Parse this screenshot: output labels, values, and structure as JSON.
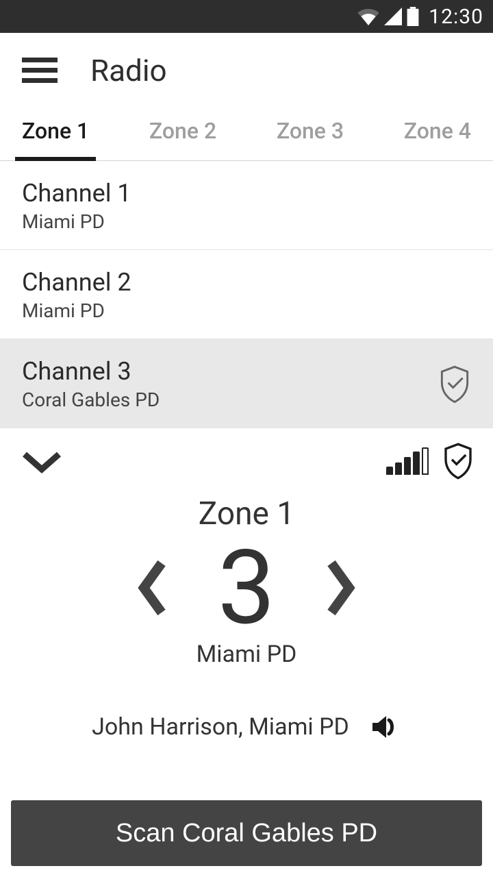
{
  "status": {
    "time": "12:30"
  },
  "header": {
    "title": "Radio"
  },
  "tabs": [
    {
      "label": "Zone 1",
      "active": true
    },
    {
      "label": "Zone 2",
      "active": false
    },
    {
      "label": "Zone 3",
      "active": false
    },
    {
      "label": "Zone 4",
      "active": false
    }
  ],
  "channels": [
    {
      "title": "Channel 1",
      "sub": "Miami PD",
      "selected": false
    },
    {
      "title": "Channel 2",
      "sub": "Miami PD",
      "selected": false
    },
    {
      "title": "Channel 3",
      "sub": "Coral Gables PD",
      "selected": true
    }
  ],
  "control": {
    "zone_label": "Zone 1",
    "channel_number": "3",
    "pd_label": "Miami PD",
    "caller": "John Harrison, Miami PD"
  },
  "scan_button_label": "Scan Coral Gables PD"
}
